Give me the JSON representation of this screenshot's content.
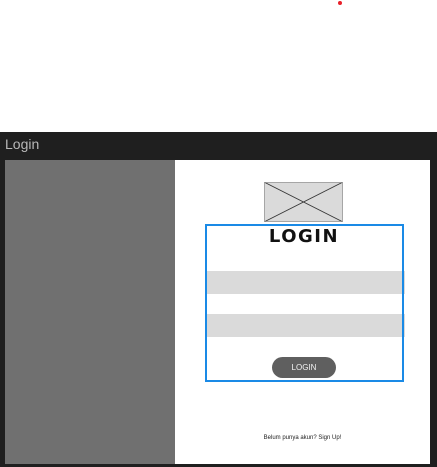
{
  "window": {
    "title": "Login"
  },
  "image_placeholder": {
    "icon": "image-placeholder-icon"
  },
  "form": {
    "heading": "LOGIN",
    "username_field": {
      "value": "",
      "placeholder": ""
    },
    "password_field": {
      "value": "",
      "placeholder": ""
    },
    "login_button_label": "LOGIN"
  },
  "footer": {
    "signup_text": "Belum punya akun? Sign Up!"
  },
  "colors": {
    "frame_background": "#1f1f1f",
    "left_panel": "#707070",
    "selection_outline": "#1a8ae6",
    "field_fill": "#dadada",
    "button_fill": "#5f5f5f",
    "indicator_dot": "#e8202a"
  }
}
